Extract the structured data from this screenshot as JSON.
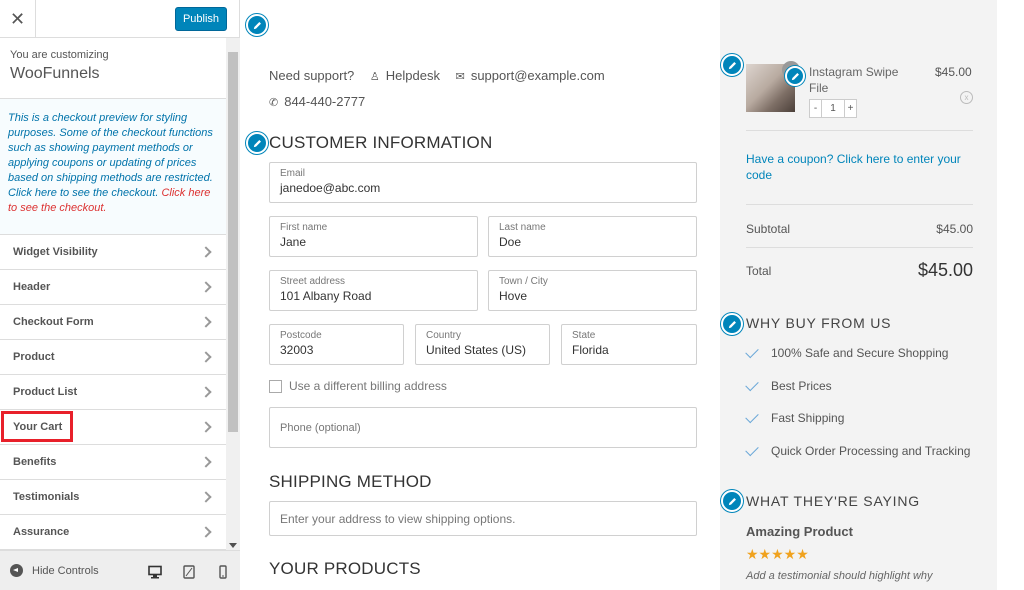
{
  "sidebar": {
    "publish_label": "Publish",
    "close_label": "✕",
    "customizing_label": "You are customizing",
    "customizing_name": "WooFunnels",
    "notice_text": "This is a checkout preview for styling purposes. Some of the checkout functions such as showing payment methods or applying coupons or updating of prices based on shipping methods are restricted. Click here to see the checkout.",
    "notice_link": "Click here to see the checkout.",
    "items": [
      {
        "label": "Widget Visibility"
      },
      {
        "label": "Header"
      },
      {
        "label": "Checkout Form"
      },
      {
        "label": "Product"
      },
      {
        "label": "Product List"
      },
      {
        "label": "Your Cart"
      },
      {
        "label": "Benefits"
      },
      {
        "label": "Testimonials"
      },
      {
        "label": "Assurance"
      }
    ],
    "hide_controls": "Hide Controls"
  },
  "main": {
    "support_label": "Need support?",
    "helpdesk": "Helpdesk",
    "email": "support@example.com",
    "phone": "844-440-2777",
    "customer_info_title": "CUSTOMER INFORMATION",
    "fields": {
      "email": {
        "label": "Email",
        "value": "janedoe@abc.com"
      },
      "first_name": {
        "label": "First name",
        "value": "Jane"
      },
      "last_name": {
        "label": "Last name",
        "value": "Doe"
      },
      "street": {
        "label": "Street address",
        "value": "101 Albany Road"
      },
      "town": {
        "label": "Town / City",
        "value": "Hove"
      },
      "postcode": {
        "label": "Postcode",
        "value": "32003"
      },
      "country": {
        "label": "Country",
        "value": "United States (US)"
      },
      "state": {
        "label": "State",
        "value": "Florida"
      },
      "phone": {
        "placeholder": "Phone (optional)"
      }
    },
    "billing_checkbox": "Use a different billing address",
    "shipping_title": "SHIPPING METHOD",
    "shipping_text": "Enter your address to view shipping options.",
    "products_title": "YOUR PRODUCTS"
  },
  "cart": {
    "badge": "1",
    "product_name": "Instagram Swipe File",
    "product_price": "$45.00",
    "remove": "x",
    "qty_minus": "-",
    "qty": "1",
    "qty_plus": "+",
    "coupon_text": "Have a coupon? Click here to enter your code",
    "subtotal_label": "Subtotal",
    "subtotal_value": "$45.00",
    "total_label": "Total",
    "total_value": "$45.00"
  },
  "benefits": {
    "title": "WHY BUY FROM US",
    "items": [
      "100% Safe and Secure Shopping",
      "Best Prices",
      "Fast Shipping",
      "Quick Order Processing and Tracking"
    ]
  },
  "testimonials": {
    "title": "WHAT THEY'RE SAYING",
    "heading": "Amazing Product",
    "stars": "★★★★★",
    "text": "Add a testimonial should highlight why"
  },
  "colors": {
    "accent": "#0085ba",
    "highlight": "#e8202a",
    "star": "#f0a21e"
  }
}
